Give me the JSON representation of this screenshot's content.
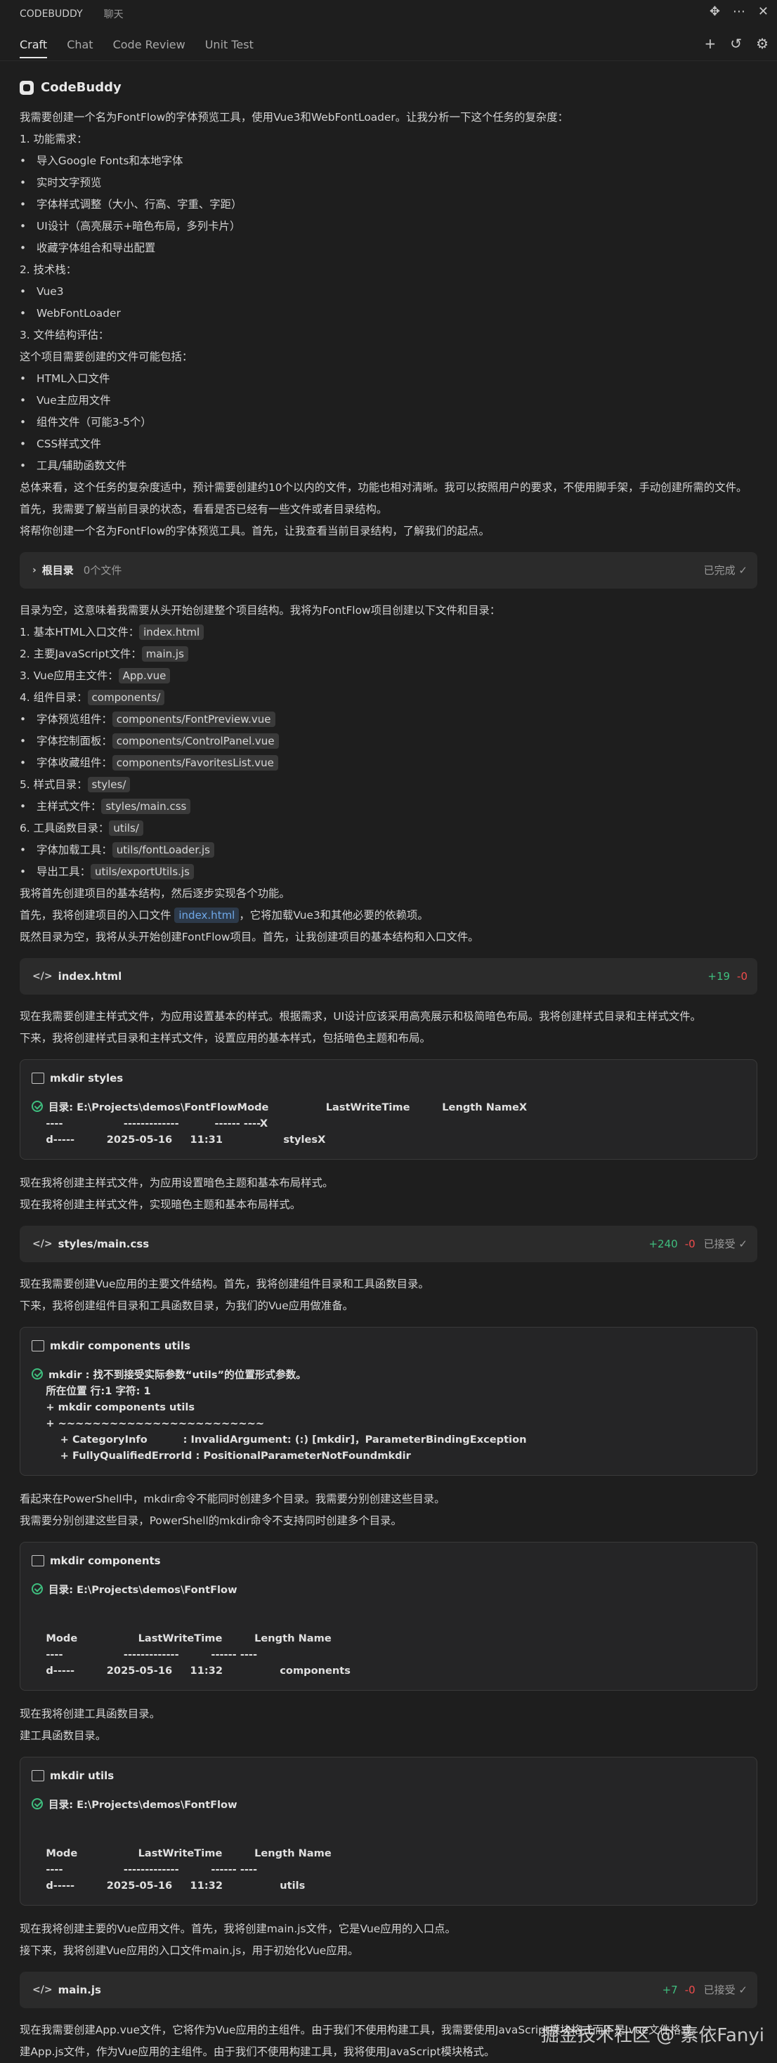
{
  "topbar": {
    "title": "CODEBUDDY",
    "chat": "聊天"
  },
  "tabs": [
    "Craft",
    "Chat",
    "Code Review",
    "Unit Test"
  ],
  "brand": "CodeBuddy",
  "intro": [
    {
      "t": "p",
      "v": "我需要创建一个名为FontFlow的字体预览工具，使用Vue3和WebFontLoader。让我分析一下这个任务的复杂度："
    },
    {
      "t": "p",
      "v": "1. 功能需求："
    },
    {
      "t": "b",
      "v": "导入Google Fonts和本地字体"
    },
    {
      "t": "b",
      "v": "实时文字预览"
    },
    {
      "t": "b",
      "v": "字体样式调整（大小、行高、字重、字距）"
    },
    {
      "t": "b",
      "v": "UI设计（高亮展示+暗色布局，多列卡片）"
    },
    {
      "t": "b",
      "v": "收藏字体组合和导出配置"
    },
    {
      "t": "p",
      "v": "2. 技术栈："
    },
    {
      "t": "b",
      "v": "Vue3"
    },
    {
      "t": "b",
      "v": "WebFontLoader"
    },
    {
      "t": "p",
      "v": "3. 文件结构评估："
    },
    {
      "t": "p",
      "v": "这个项目需要创建的文件可能包括："
    },
    {
      "t": "b",
      "v": "HTML入口文件"
    },
    {
      "t": "b",
      "v": "Vue主应用文件"
    },
    {
      "t": "b",
      "v": "组件文件（可能3-5个）"
    },
    {
      "t": "b",
      "v": "CSS样式文件"
    },
    {
      "t": "b",
      "v": "工具/辅助函数文件"
    },
    {
      "t": "p",
      "v": "总体来看，这个任务的复杂度适中，预计需要创建约10个以内的文件，功能也相对清晰。我可以按照用户的要求，不使用脚手架，手动创建所需的文件。"
    },
    {
      "t": "p",
      "v": "首先，我需要了解当前目录的状态，看看是否已经有一些文件或者目录结构。"
    },
    {
      "t": "p",
      "v": "将帮你创建一个名为FontFlow的字体预览工具。首先，让我查看当前目录结构，了解我们的起点。"
    }
  ],
  "root_panel": {
    "title": "根目录",
    "count": "0个文件",
    "status": "已完成 ✓"
  },
  "plan": [
    {
      "t": "p",
      "v": "目录为空，这意味着我需要从头开始创建整个项目结构。我将为FontFlow项目创建以下文件和目录："
    },
    {
      "t": "pc",
      "v": "1. 基本HTML入口文件：",
      "c": "index.html"
    },
    {
      "t": "pc",
      "v": "2. 主要JavaScript文件：",
      "c": "main.js"
    },
    {
      "t": "pc",
      "v": "3. Vue应用主文件：",
      "c": "App.vue"
    },
    {
      "t": "pc",
      "v": "4. 组件目录：",
      "c": "components/"
    },
    {
      "t": "bc",
      "v": "字体预览组件：",
      "c": "components/FontPreview.vue"
    },
    {
      "t": "bc",
      "v": "字体控制面板：",
      "c": "components/ControlPanel.vue"
    },
    {
      "t": "bc",
      "v": "字体收藏组件：",
      "c": "components/FavoritesList.vue"
    },
    {
      "t": "pc",
      "v": "5. 样式目录：",
      "c": "styles/"
    },
    {
      "t": "bc",
      "v": "主样式文件：",
      "c": "styles/main.css"
    },
    {
      "t": "pc",
      "v": "6. 工具函数目录：",
      "c": "utils/"
    },
    {
      "t": "bc",
      "v": "字体加载工具：",
      "c": "utils/fontLoader.js"
    },
    {
      "t": "bc",
      "v": "导出工具：",
      "c": "utils/exportUtils.js"
    },
    {
      "t": "p",
      "v": "我将首先创建项目的基本结构，然后逐步实现各个功能。"
    },
    {
      "t": "link",
      "a": "首先，我将创建项目的入口文件 ",
      "c": "index.html",
      "b": "，它将加载Vue3和其他必要的依赖项。"
    },
    {
      "t": "p",
      "v": "既然目录为空，我将从头开始创建FontFlow项目。首先，让我创建项目的基本结构和入口文件。"
    }
  ],
  "file1": {
    "name": "index.html",
    "add": "+19",
    "del": "-0"
  },
  "after_file1": [
    "现在我需要创建主样式文件，为应用设置基本的样式。根据需求，UI设计应该采用高亮展示和极简暗色布局。我将创建样式目录和主样式文件。",
    "下来，我将创建样式目录和主样式文件，设置应用的基本样式，包括暗色主题和布局。"
  ],
  "term1": {
    "title": "mkdir styles",
    "lines": [
      {
        "check": true,
        "v": "目录: E:\\Projects\\demos\\FontFlowMode                LastWriteTime         Length NameX"
      },
      {
        "v": "    ----                 -------------          ------ ----X"
      },
      {
        "v": "    d-----         2025-05-16     11:31                 stylesX"
      }
    ]
  },
  "after_term1": [
    "现在我将创建主样式文件，为应用设置暗色主题和基本布局样式。",
    "现在我将创建主样式文件，实现暗色主题和基本布局样式。"
  ],
  "file2": {
    "name": "styles/main.css",
    "add": "+240",
    "del": "-0",
    "status": "已接受 ✓"
  },
  "after_file2": [
    "现在我需要创建Vue应用的主要文件结构。首先，我将创建组件目录和工具函数目录。",
    "下来，我将创建组件目录和工具函数目录，为我们的Vue应用做准备。"
  ],
  "term2": {
    "title": "mkdir components utils",
    "lines": [
      {
        "check": true,
        "v": "mkdir : 找不到接受实际参数“utils”的位置形式参数。"
      },
      {
        "v": "    所在位置 行:1 字符: 1"
      },
      {
        "v": "    + mkdir components utils"
      },
      {
        "v": "    + ~~~~~~~~~~~~~~~~~~~~~~~~"
      },
      {
        "v": "        + CategoryInfo          : InvalidArgument: (:) [mkdir]，ParameterBindingException"
      },
      {
        "v": "        + FullyQualifiedErrorId : PositionalParameterNotFoundmkdir"
      }
    ]
  },
  "after_term2": [
    "看起来在PowerShell中，mkdir命令不能同时创建多个目录。我需要分别创建这些目录。",
    "我需要分别创建这些目录，PowerShell的mkdir命令不支持同时创建多个目录。"
  ],
  "term3": {
    "title": "mkdir components",
    "lines": [
      {
        "check": true,
        "v": "目录: E:\\Projects\\demos\\FontFlow"
      },
      {
        "v": " "
      },
      {
        "v": " "
      },
      {
        "v": "    Mode                 LastWriteTime         Length Name"
      },
      {
        "v": "    ----                 -------------         ------ ----"
      },
      {
        "v": "    d-----         2025-05-16     11:32                components"
      }
    ]
  },
  "after_term3": [
    "现在我将创建工具函数目录。",
    "建工具函数目录。"
  ],
  "term4": {
    "title": "mkdir utils",
    "lines": [
      {
        "check": true,
        "v": "目录: E:\\Projects\\demos\\FontFlow"
      },
      {
        "v": " "
      },
      {
        "v": " "
      },
      {
        "v": "    Mode                 LastWriteTime         Length Name"
      },
      {
        "v": "    ----                 -------------         ------ ----"
      },
      {
        "v": "    d-----         2025-05-16     11:32                utils"
      }
    ]
  },
  "after_term4": [
    "现在我将创建主要的Vue应用文件。首先，我将创建main.js文件，它是Vue应用的入口点。",
    "接下来，我将创建Vue应用的入口文件main.js，用于初始化Vue应用。"
  ],
  "file3": {
    "name": "main.js",
    "add": "+7",
    "del": "-0",
    "status": "已接受 ✓"
  },
  "tail": [
    "现在我需要创建App.vue文件，它将作为Vue应用的主组件。由于我们不使用构建工具，我需要使用JavaScript模块格式而不是.vue文件格式。",
    "建App.js文件，作为Vue应用的主组件。由于我们不使用构建工具，我将使用JavaScript模块格式。"
  ],
  "watermark": "掘金技术社区 @ 素依Fanyi"
}
